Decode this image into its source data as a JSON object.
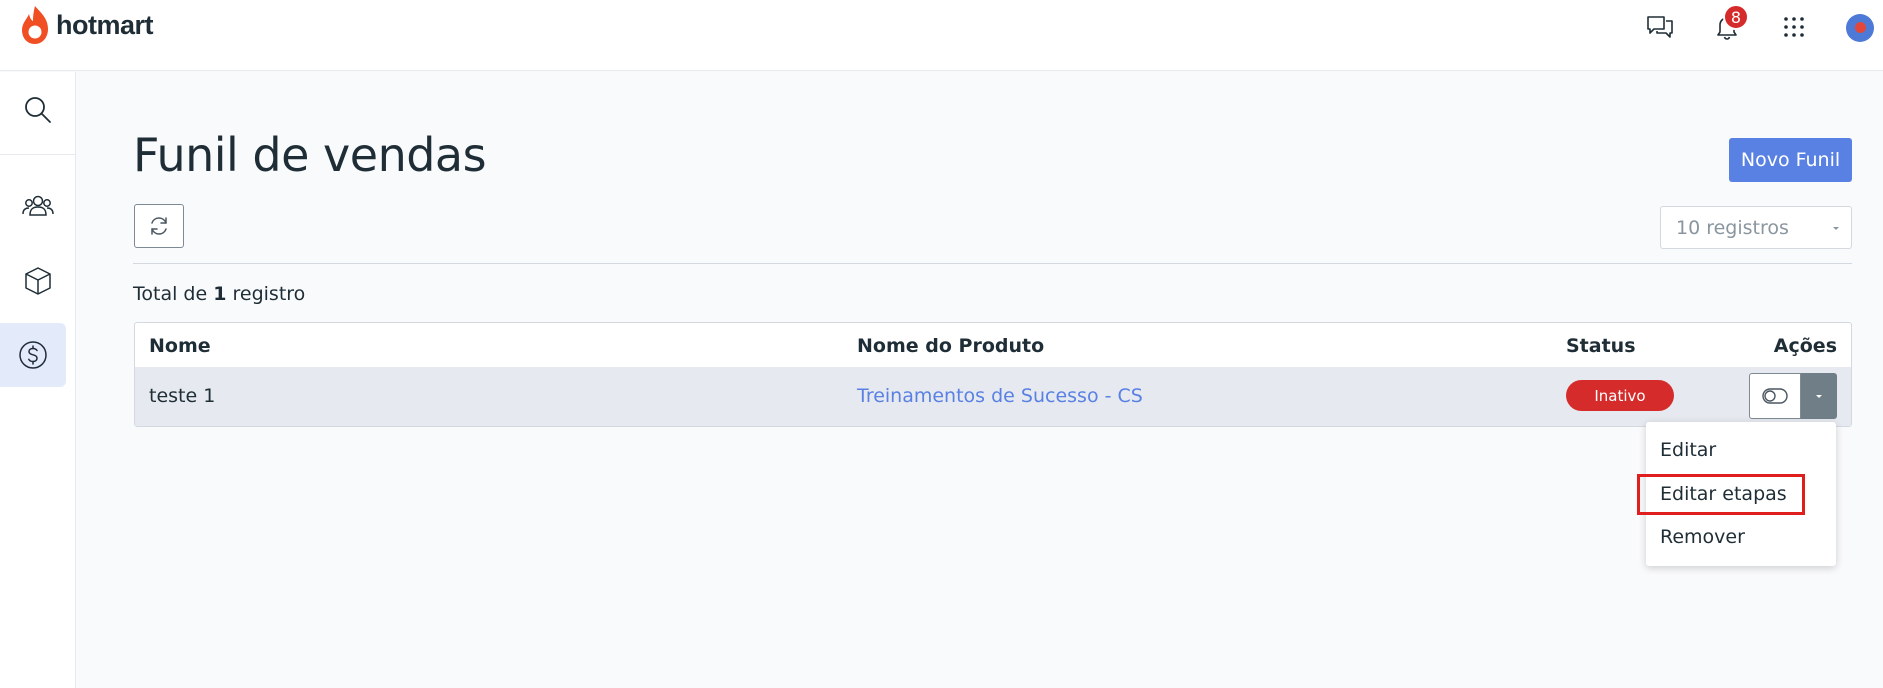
{
  "brand": {
    "name": "hotmart",
    "color": "#f04e23"
  },
  "topbar": {
    "chat_icon": "chat-bubbles-icon",
    "bell_icon": "bell-icon",
    "notification_count": "8",
    "apps_icon": "grid-icon"
  },
  "sidebar": {
    "items": [
      {
        "icon": "search-icon"
      },
      {
        "icon": "users-icon"
      },
      {
        "icon": "box-icon"
      },
      {
        "icon": "dollar-icon",
        "active": true
      }
    ]
  },
  "page": {
    "title": "Funil de vendas",
    "new_button": "Novo Funil",
    "page_size": "10 registros",
    "total_prefix": "Total de",
    "total_count": "1",
    "total_suffix": "registro"
  },
  "table": {
    "headers": [
      "Nome",
      "Nome do Produto",
      "Status",
      "Ações"
    ],
    "rows": [
      {
        "name": "teste 1",
        "product": "Treinamentos de Sucesso - CS",
        "status": "Inativo"
      }
    ]
  },
  "actions_menu": {
    "items": [
      "Editar",
      "Editar etapas",
      "Remover"
    ],
    "highlighted": "Editar etapas"
  },
  "colors": {
    "primary": "#5981e3",
    "danger": "#d62b2b",
    "highlight_border": "#e01e1e"
  }
}
